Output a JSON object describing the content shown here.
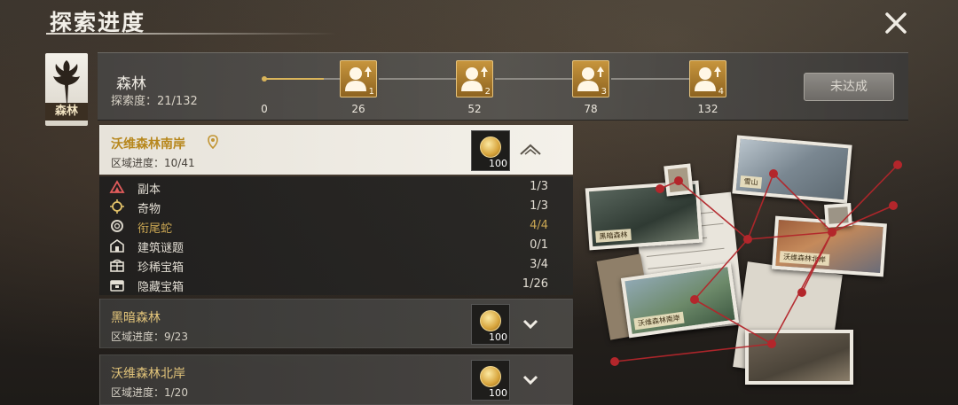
{
  "page": {
    "title": "探索进度"
  },
  "region": {
    "label": "森林"
  },
  "header": {
    "zone_name": "森林",
    "progress_text": "探索度：21/132",
    "progress_current": 21,
    "progress_total": 132,
    "milestones": [
      {
        "value": "0"
      },
      {
        "value": "26",
        "num": "1"
      },
      {
        "value": "52",
        "num": "2"
      },
      {
        "value": "78",
        "num": "3"
      },
      {
        "value": "132",
        "num": "4"
      }
    ],
    "status_button": "未达成"
  },
  "subregions": [
    {
      "name": "沃维森林南岸",
      "progress": "区域进度：10/41",
      "reward_count": "100",
      "expanded": true,
      "items": [
        {
          "icon": "dungeon-icon",
          "label": "副本",
          "value": "1/3"
        },
        {
          "icon": "curiosity-icon",
          "label": "奇物",
          "value": "1/3"
        },
        {
          "icon": "ouroboros-icon",
          "label": "衔尾蛇",
          "value": "4/4",
          "done": true
        },
        {
          "icon": "building-puzzle-icon",
          "label": "建筑谜题",
          "value": "0/1"
        },
        {
          "icon": "rare-chest-icon",
          "label": "珍稀宝箱",
          "value": "3/4"
        },
        {
          "icon": "hidden-chest-icon",
          "label": "隐藏宝箱",
          "value": "1/26"
        }
      ]
    },
    {
      "name": "黑暗森林",
      "progress": "区域进度：9/23",
      "reward_count": "100",
      "expanded": false
    },
    {
      "name": "沃维森林北岸",
      "progress": "区域进度：1/20",
      "reward_count": "100",
      "expanded": false
    }
  ],
  "map": {
    "captions": {
      "p1": "黑暗森林",
      "p2": "雪山",
      "p3": "沃维森林北岸",
      "p4": "沃维森林南岸"
    },
    "pin_color": "#b3262b"
  }
}
